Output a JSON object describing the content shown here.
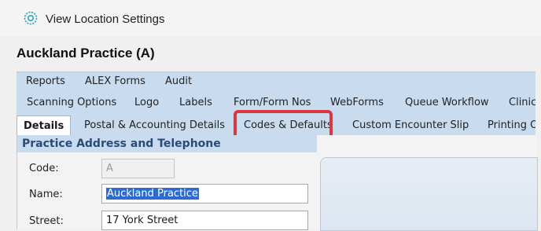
{
  "window": {
    "title": "View Location Settings",
    "app_icon": "gear-ring-icon"
  },
  "page": {
    "heading": "Auckland Practice (A)"
  },
  "tabs": {
    "row1": [
      "Reports",
      "ALEX Forms",
      "Audit"
    ],
    "row2": [
      "Scanning Options",
      "Logo",
      "Labels",
      "Form/Form Nos",
      "WebForms",
      "Queue Workflow",
      "Clinic"
    ],
    "row3": [
      "Details",
      "Postal & Accounting Details",
      "Codes & Defaults",
      "Custom Encounter Slip",
      "Printing O"
    ],
    "active": "Details",
    "highlighted": "Codes & Defaults"
  },
  "section": {
    "title": "Practice Address and Telephone"
  },
  "fields": {
    "code": {
      "label": "Code:",
      "value": "A"
    },
    "name": {
      "label": "Name:",
      "value": "Auckland Practice"
    },
    "street": {
      "label": "Street:",
      "value": "17 York Street"
    }
  },
  "colors": {
    "tab_background": "#c9dcef",
    "section_title": "#2c4a78",
    "highlight_border": "#d9383e",
    "selection": "#2e6bd1"
  }
}
